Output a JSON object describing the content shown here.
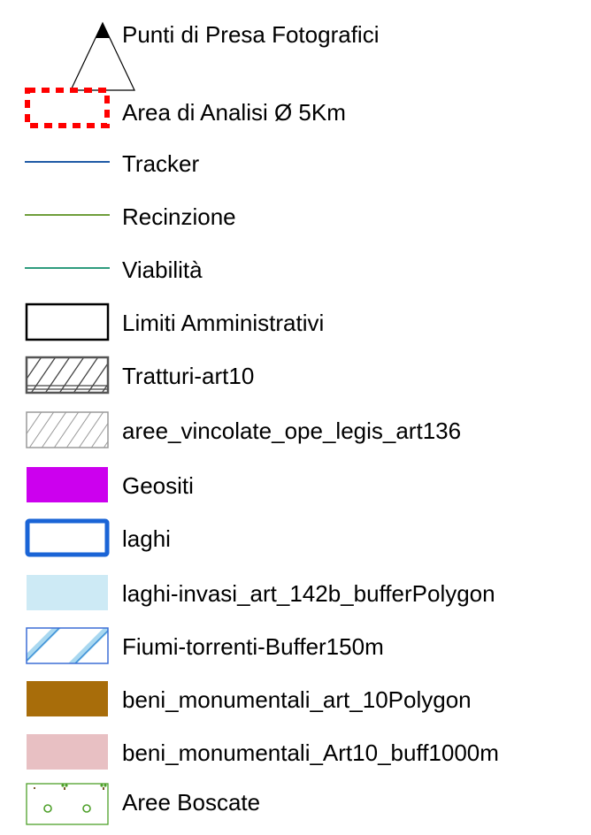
{
  "legend": {
    "items": [
      {
        "label": "Punti di Presa Fotografici",
        "symbol": "triangle-marker-icon",
        "color": "#000000"
      },
      {
        "label": "Area di Analisi Ø 5Km",
        "symbol": "dashed-rectangle-icon",
        "color": "#ff0000"
      },
      {
        "label": "Tracker",
        "symbol": "line-icon",
        "color": "#1f5aa6"
      },
      {
        "label": "Recinzione",
        "symbol": "line-icon",
        "color": "#6f9e3b"
      },
      {
        "label": "Viabilità",
        "symbol": "line-icon",
        "color": "#2e9c7e"
      },
      {
        "label": "Limiti Amministrativi",
        "symbol": "outline-rectangle-icon",
        "color": "#000000"
      },
      {
        "label": "Tratturi-art10",
        "symbol": "hatched-rectangle-icon",
        "color": "#555555"
      },
      {
        "label": "aree_vincolate_ope_legis_art136",
        "symbol": "light-hatched-rectangle-icon",
        "color": "#9a9a9a"
      },
      {
        "label": "Geositi",
        "symbol": "filled-rectangle-icon",
        "color": "#cc00ee"
      },
      {
        "label": "laghi",
        "symbol": "blue-outline-rectangle-icon",
        "color": "#1a64d6"
      },
      {
        "label": "laghi-invasi_art_142b_bufferPolygon",
        "symbol": "filled-rectangle-icon",
        "color": "#cdeaf5"
      },
      {
        "label": "Fiumi-torrenti-Buffer150m",
        "symbol": "blue-hatched-rectangle-icon",
        "color": "#3d8fd6"
      },
      {
        "label": "beni_monumentali_art_10Polygon",
        "symbol": "filled-rectangle-icon",
        "color": "#a86d0a"
      },
      {
        "label": "beni_monumentali_Art10_buff1000m",
        "symbol": "filled-rectangle-icon",
        "color": "#e8c0c3"
      },
      {
        "label": "Aree Boscate",
        "symbol": "tree-pattern-rectangle-icon",
        "color": "#4ea02a"
      }
    ]
  }
}
